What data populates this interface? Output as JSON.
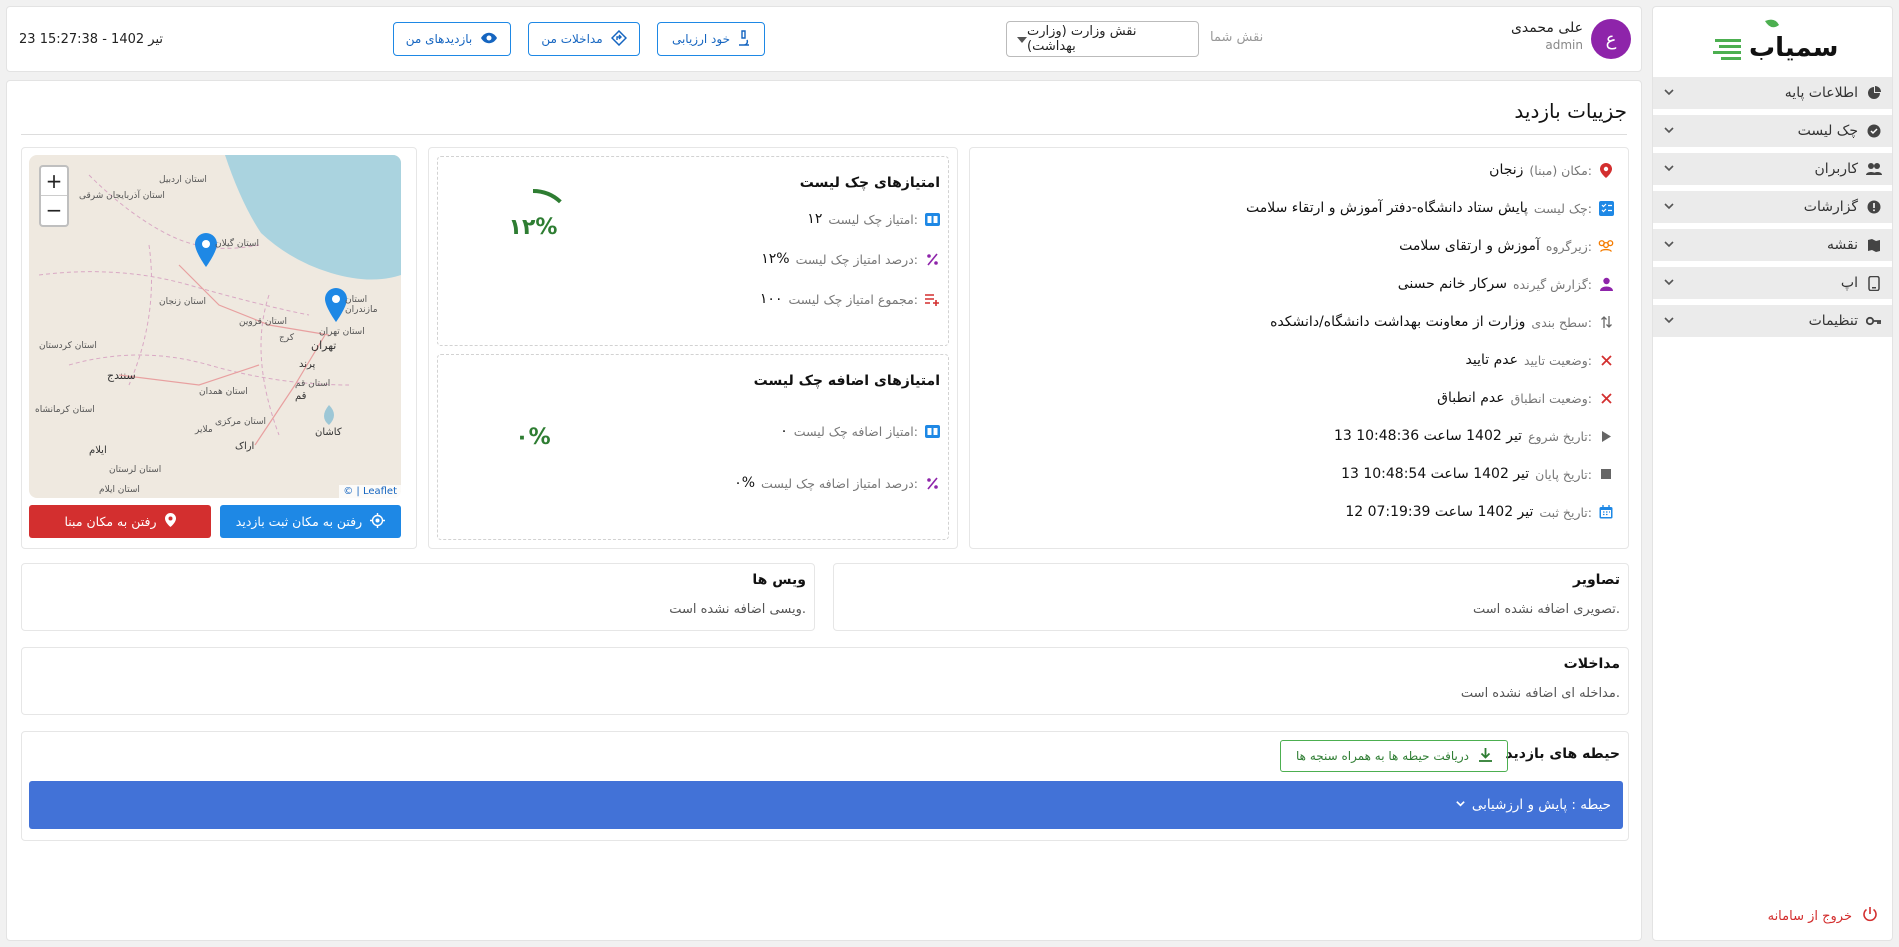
{
  "sidebar": {
    "logo_text": "سمیاب",
    "items": [
      {
        "label": "اطلاعات پایه",
        "icon": "pie-chart-icon"
      },
      {
        "label": "چک لیست",
        "icon": "check-circle-icon"
      },
      {
        "label": "کاربران",
        "icon": "users-icon"
      },
      {
        "label": "گزارشات",
        "icon": "alert-circle-icon"
      },
      {
        "label": "نقشه",
        "icon": "map-icon"
      },
      {
        "label": "اپ",
        "icon": "phone-icon"
      },
      {
        "label": "تنظیمات",
        "icon": "key-icon"
      }
    ],
    "logout_label": "خروج از سامانه"
  },
  "header": {
    "user_initial": "ع",
    "user_name": "علی محمدی",
    "user_role": "admin",
    "role_label": "نقش شما",
    "role_value": "نقش وزارت (وزارت بهداشت)",
    "buttons": {
      "self_assessment": "خود ارزیابی",
      "my_interventions": "مداخلات من",
      "my_visits": "بازدیدهای من"
    },
    "datetime": "23 تیر 1402 - 15:27:38"
  },
  "page": {
    "title": "جزییات بازدید"
  },
  "details": {
    "location": {
      "label": "مکان (مبنا):",
      "value": "زنجان"
    },
    "checklist": {
      "label": "چک لیست:",
      "value": "پایش ستاد دانشگاه-دفتر آموزش و ارتقاء سلامت"
    },
    "subgroup": {
      "label": "زیرگروه:",
      "value": "آموزش و ارتقای سلامت"
    },
    "reporter": {
      "label": "گزارش گیرنده:",
      "value": "سرکار خانم حسنی"
    },
    "level": {
      "label": "سطح بندی:",
      "value": "وزارت از معاونت بهداشت دانشگاه/دانشکده"
    },
    "approval": {
      "label": "وضعیت تایید:",
      "value": "عدم تایید"
    },
    "compliance": {
      "label": "وضعیت انطباق:",
      "value": "عدم انطباق"
    },
    "start": {
      "label": "تاریخ شروع:",
      "value": "13 تیر 1402 ساعت 10:48:36"
    },
    "end": {
      "label": "تاریخ پایان:",
      "value": "13 تیر 1402 ساعت 10:48:54"
    },
    "registered": {
      "label": "تاریخ ثبت:",
      "value": "12 تیر 1402 ساعت 07:19:39"
    }
  },
  "scores": {
    "title": "امتیازهای چک لیست",
    "score_label": "امتیاز چک لیست:",
    "score_value": "۱۲",
    "percent_label": "درصد امتیاز چک لیست:",
    "percent_value": "۱۲%",
    "total_label": "مجموع امتیاز چک لیست:",
    "total_value": "۱۰۰",
    "gauge_text": "۱۲%",
    "gauge_fraction": 0.12
  },
  "extra_scores": {
    "title": "امتیازهای اضافه چک لیست",
    "score_label": "امتیاز اضافه چک لیست:",
    "score_value": "۰",
    "percent_label": "درصد امتیاز اضافه چک لیست:",
    "percent_value": "۰%",
    "gauge_text": "۰%",
    "gauge_fraction": 0
  },
  "map": {
    "zoom_in": "+",
    "zoom_out": "−",
    "attribution": "© | Leaflet",
    "labels": [
      "استان گیلان",
      "استان آذربایجان شرقی",
      "استان اردبیل",
      "استان زنجان",
      "استان قزوین",
      "استان تهران",
      "تهران",
      "استان مازندران",
      "کرج",
      "سنندج",
      "استان همدان",
      "استان کردستان",
      "استان مرکزی",
      "استان قم",
      "قم",
      "کاشان",
      "اراک",
      "ملایر",
      "استان کرمانشاه",
      "استان لرستان",
      "استان ایلام",
      "ایلام",
      "پرند"
    ],
    "btn_visit_location": "رفتن به مکان ثبت بازدید",
    "btn_base_location": "رفتن به مکان مبنا"
  },
  "images": {
    "title": "تصاویر",
    "empty": "تصویری اضافه نشده است."
  },
  "voices": {
    "title": "ویس ها",
    "empty": "ویسی اضافه نشده است."
  },
  "interventions": {
    "title": "مداخلات",
    "empty": "مداخله ای اضافه نشده است."
  },
  "domains": {
    "title": "حیطه های بازدید",
    "download_label": "دریافت حیطه ها به همراه سنجه ها",
    "accordion_label": "حیطه : پایش و ارزشیابی"
  },
  "colors": {
    "primary_blue": "#1e88e5",
    "accordion_blue": "#4272d7",
    "danger_red": "#d32f2f",
    "success_green": "#2e7d32",
    "avatar_purple": "#8e24aa"
  }
}
